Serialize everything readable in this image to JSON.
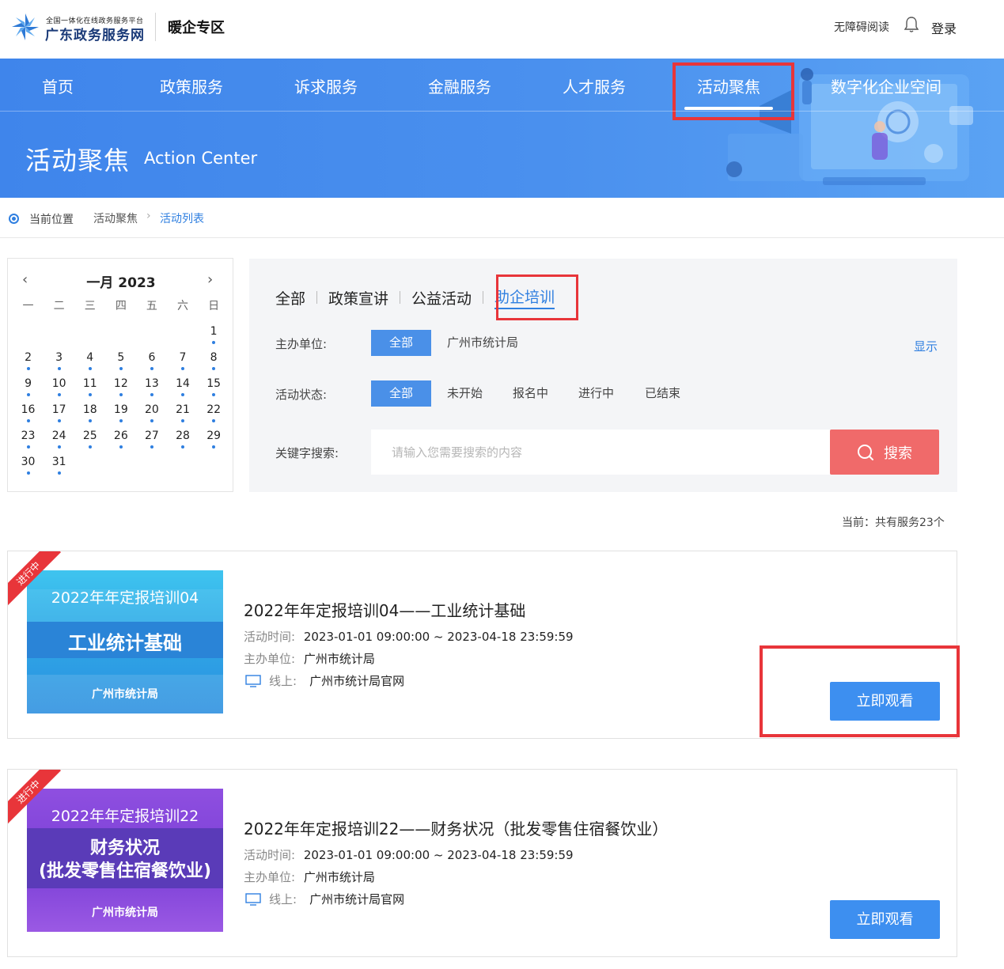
{
  "header": {
    "logo_small": "全国一体化在线政务服务平台",
    "logo_big": "广东政务服务网",
    "zone": "暖企专区",
    "accessibility": "无障碍阅读",
    "login": "登录"
  },
  "nav": {
    "items": [
      "首页",
      "政策服务",
      "诉求服务",
      "金融服务",
      "人才服务",
      "活动聚焦",
      "数字化企业空间"
    ],
    "active_index": 5
  },
  "banner": {
    "title": "活动聚焦",
    "subtitle": "Action Center"
  },
  "breadcrumb": {
    "label": "当前位置",
    "items": [
      "活动聚焦",
      "活动列表"
    ]
  },
  "calendar": {
    "title": "一月 2023",
    "weekdays": [
      "一",
      "二",
      "三",
      "四",
      "五",
      "六",
      "日"
    ],
    "weeks": [
      [
        "",
        "",
        "",
        "",
        "",
        "",
        "1"
      ],
      [
        "2",
        "3",
        "4",
        "5",
        "6",
        "7",
        "8"
      ],
      [
        "9",
        "10",
        "11",
        "12",
        "13",
        "14",
        "15"
      ],
      [
        "16",
        "17",
        "18",
        "19",
        "20",
        "21",
        "22"
      ],
      [
        "23",
        "24",
        "25",
        "26",
        "27",
        "28",
        "29"
      ],
      [
        "30",
        "31",
        "",
        "",
        "",
        "",
        ""
      ]
    ]
  },
  "filter": {
    "tabs": [
      "全部",
      "政策宣讲",
      "公益活动",
      "助企培训"
    ],
    "active_tab": 3,
    "host_label": "主办单位:",
    "host_options": [
      "全部",
      "广州市统计局"
    ],
    "show_link": "显示",
    "status_label": "活动状态:",
    "status_options": [
      "全部",
      "未开始",
      "报名中",
      "进行中",
      "已结束"
    ],
    "keyword_label": "关键字搜索:",
    "search_placeholder": "请输入您需要搜索的内容",
    "search_button": "搜索"
  },
  "result_count": "当前：共有服务23个",
  "activities": [
    {
      "status": "进行中",
      "thumb_line1": "2022年年定报培训04",
      "thumb_line2": "工业统计基础",
      "thumb_line3": "",
      "thumb_org": "广州市统计局",
      "title": "2022年年定报培训04——工业统计基础",
      "time_label": "活动时间:",
      "time": "2023-01-01 09:00:00 ~ 2023-04-18 23:59:59",
      "host_label": "主办单位:",
      "host": "广州市统计局",
      "online_label": "线上:",
      "online": "广州市统计局官网",
      "button": "立即观看"
    },
    {
      "status": "进行中",
      "thumb_line1": "2022年年定报培训22",
      "thumb_line2": "财务状况",
      "thumb_line3": "(批发零售住宿餐饮业)",
      "thumb_org": "广州市统计局",
      "title": "2022年年定报培训22——财务状况（批发零售住宿餐饮业）",
      "time_label": "活动时间:",
      "time": "2023-01-01 09:00:00 ~ 2023-04-18 23:59:59",
      "host_label": "主办单位:",
      "host": "广州市统计局",
      "online_label": "线上:",
      "online": "广州市统计局官网",
      "button": "立即观看"
    }
  ],
  "colors": {
    "nav_blue": "#4a90ee",
    "accent_blue": "#2f7fe0",
    "highlight_red": "#e8353a",
    "search_red": "#f06a6a"
  }
}
